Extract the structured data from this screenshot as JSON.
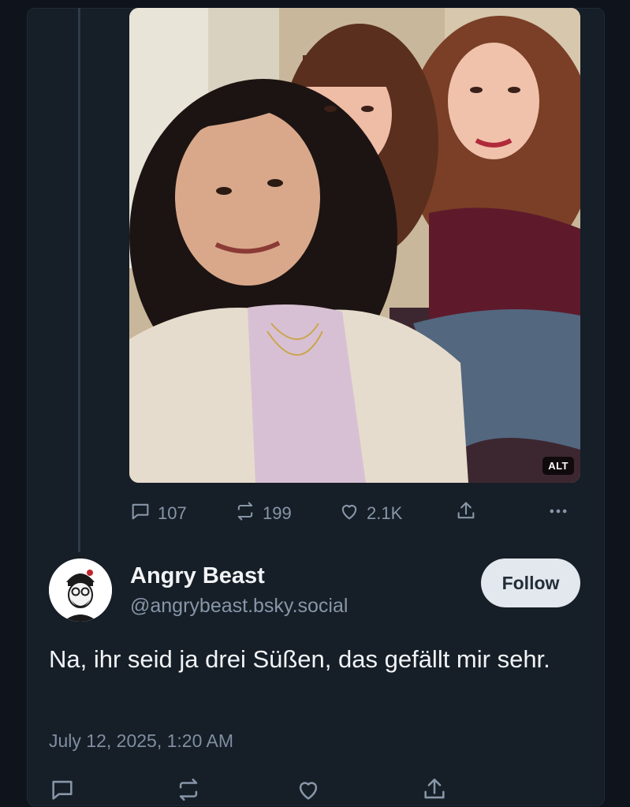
{
  "image": {
    "alt_badge": "ALT",
    "alt_text": "Selfie of three smiling women sitting together on a couch"
  },
  "actions": {
    "replies": "107",
    "reposts": "199",
    "likes": "2.1K",
    "icons": [
      "reply-icon",
      "repost-icon",
      "like-icon",
      "share-icon",
      "more-icon"
    ]
  },
  "reply": {
    "author_name": "Angry Beast",
    "author_handle": "@angrybeast.bsky.social",
    "follow_label": "Follow",
    "text": "Na, ihr seid ja drei Süßen, das gefällt mir sehr.",
    "timestamp": "July 12, 2025, 1:20 AM"
  },
  "colors": {
    "background": "#0f141c",
    "card": "#161e27",
    "muted_text": "#8796a8",
    "follow_button": "#e3e8ee"
  }
}
